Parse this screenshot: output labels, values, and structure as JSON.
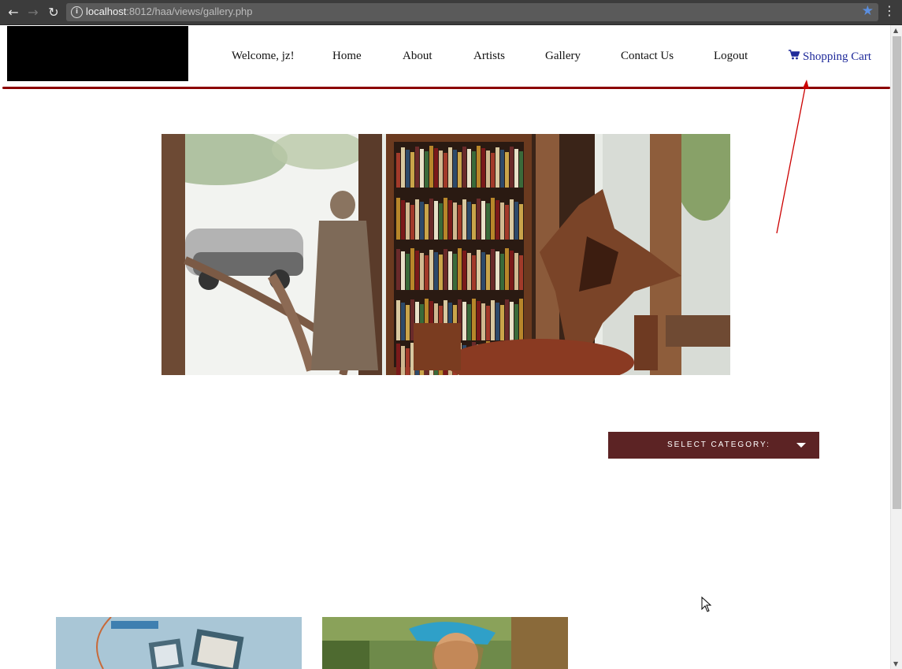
{
  "browser": {
    "url_host": "localhost",
    "url_rest": ":8012/haa/views/gallery.php",
    "back_icon": "back-arrow-icon",
    "forward_icon": "forward-arrow-icon",
    "reload_icon": "reload-icon",
    "info_icon": "info-icon",
    "bookmark_icon": "star-icon",
    "menu_icon": "kebab-menu-icon"
  },
  "nav": {
    "welcome": "Welcome, jz!",
    "home": "Home",
    "about": "About",
    "artists": "Artists",
    "gallery": "Gallery",
    "contact": "Contact Us",
    "logout": "Logout",
    "cart": "Shopping Cart",
    "cart_icon": "shopping-cart-icon"
  },
  "colors": {
    "header_rule": "#8b0000",
    "category_bg": "#5c2324",
    "cart_link": "#1f2a9a",
    "annotation_arrow": "#cc0000"
  },
  "category_dropdown": {
    "label": "SELECT CATEGORY:"
  }
}
